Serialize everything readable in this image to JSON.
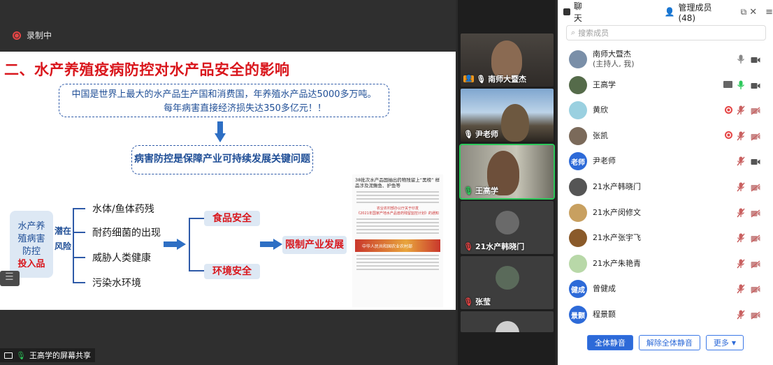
{
  "recording": {
    "label": "录制中"
  },
  "slide": {
    "title": "二、水产养殖疫病防控对水产品安全的影响",
    "box1_line1": "中国是世界上最大的水产品生产国和消费国，年养殖水产品达5000多万吨。",
    "box1_line2": "每年病害直接经济损失达350多亿元！！",
    "box2": "病害防控是保障产业可持续发展关键问题",
    "left_lines": [
      "水产养",
      "殖病害",
      "防控"
    ],
    "left_red": "投入品",
    "risk_lines": [
      "潜在",
      "风险"
    ],
    "branches": [
      "水体/鱼体药残",
      "耐药细菌的出现",
      "威胁人类健康",
      "污染水环境"
    ],
    "outcome_top": "食品安全",
    "outcome_bottom": "环境安全",
    "result": "限制产业发展",
    "doc_title": "38批次水产品国抽出药物残留上“黑榜” 样品涉及泥鳅鱼、护鱼等",
    "doc_red_line1": "农业农村部办公厅关于印发",
    "doc_red_line2": "《2021年国家产地水产品兽药残留监控计划》的通知",
    "doc_banner": "中华人民共和国农业农村部"
  },
  "sharebar": {
    "label": "王高学的屏幕共享"
  },
  "videos": [
    {
      "name": "南师大暨杰",
      "host": true,
      "active": false
    },
    {
      "name": "尹老师",
      "host": false,
      "active": false
    },
    {
      "name": "王高学",
      "host": false,
      "active": true
    },
    {
      "name": "21水产韩晓门",
      "host": false,
      "active": false
    },
    {
      "name": "张莹",
      "host": false,
      "active": false
    }
  ],
  "panel": {
    "tab_chat": "聊天",
    "tab_members": "管理成员 (48)",
    "search_placeholder": "搜索成员",
    "members": [
      {
        "name": "南师大暨杰",
        "sub": "(主持人, 我)",
        "avatar_text": "",
        "avatar_color": "#7a8fa8",
        "recording": false,
        "mic": "on",
        "cam": "on",
        "share": false
      },
      {
        "name": "王高学",
        "sub": "",
        "avatar_text": "",
        "avatar_color": "#556b4a",
        "recording": false,
        "mic": "active",
        "cam": "on",
        "share": true
      },
      {
        "name": "黄欣",
        "sub": "",
        "avatar_text": "",
        "avatar_color": "#9ad0e0",
        "recording": true,
        "mic": "muted",
        "cam": "off",
        "share": false
      },
      {
        "name": "张凯",
        "sub": "",
        "avatar_text": "",
        "avatar_color": "#7b6a5a",
        "recording": true,
        "mic": "muted",
        "cam": "off",
        "share": false
      },
      {
        "name": "尹老师",
        "sub": "",
        "avatar_text": "老师",
        "avatar_color": "#2d6ad8",
        "recording": false,
        "mic": "muted",
        "cam": "on",
        "share": false
      },
      {
        "name": "21水产韩晓门",
        "sub": "",
        "avatar_text": "",
        "avatar_color": "#555555",
        "recording": false,
        "mic": "muted",
        "cam": "off",
        "share": false
      },
      {
        "name": "21水产闵修文",
        "sub": "",
        "avatar_text": "",
        "avatar_color": "#c8a060",
        "recording": false,
        "mic": "muted",
        "cam": "off",
        "share": false
      },
      {
        "name": "21水产张宇飞",
        "sub": "",
        "avatar_text": "",
        "avatar_color": "#8a5a2a",
        "recording": false,
        "mic": "muted",
        "cam": "off",
        "share": false
      },
      {
        "name": "21水产朱艳青",
        "sub": "",
        "avatar_text": "",
        "avatar_color": "#b8d8a8",
        "recording": false,
        "mic": "muted",
        "cam": "off",
        "share": false
      },
      {
        "name": "曾健成",
        "sub": "",
        "avatar_text": "健成",
        "avatar_color": "#2d6ad8",
        "recording": false,
        "mic": "muted",
        "cam": "off",
        "share": false
      },
      {
        "name": "程景颢",
        "sub": "",
        "avatar_text": "景颢",
        "avatar_color": "#2d6ad8",
        "recording": false,
        "mic": "muted",
        "cam": "off",
        "share": false
      }
    ],
    "btn_mute_all": "全体静音",
    "btn_unmute_all": "解除全体静音",
    "btn_more": "更多"
  }
}
